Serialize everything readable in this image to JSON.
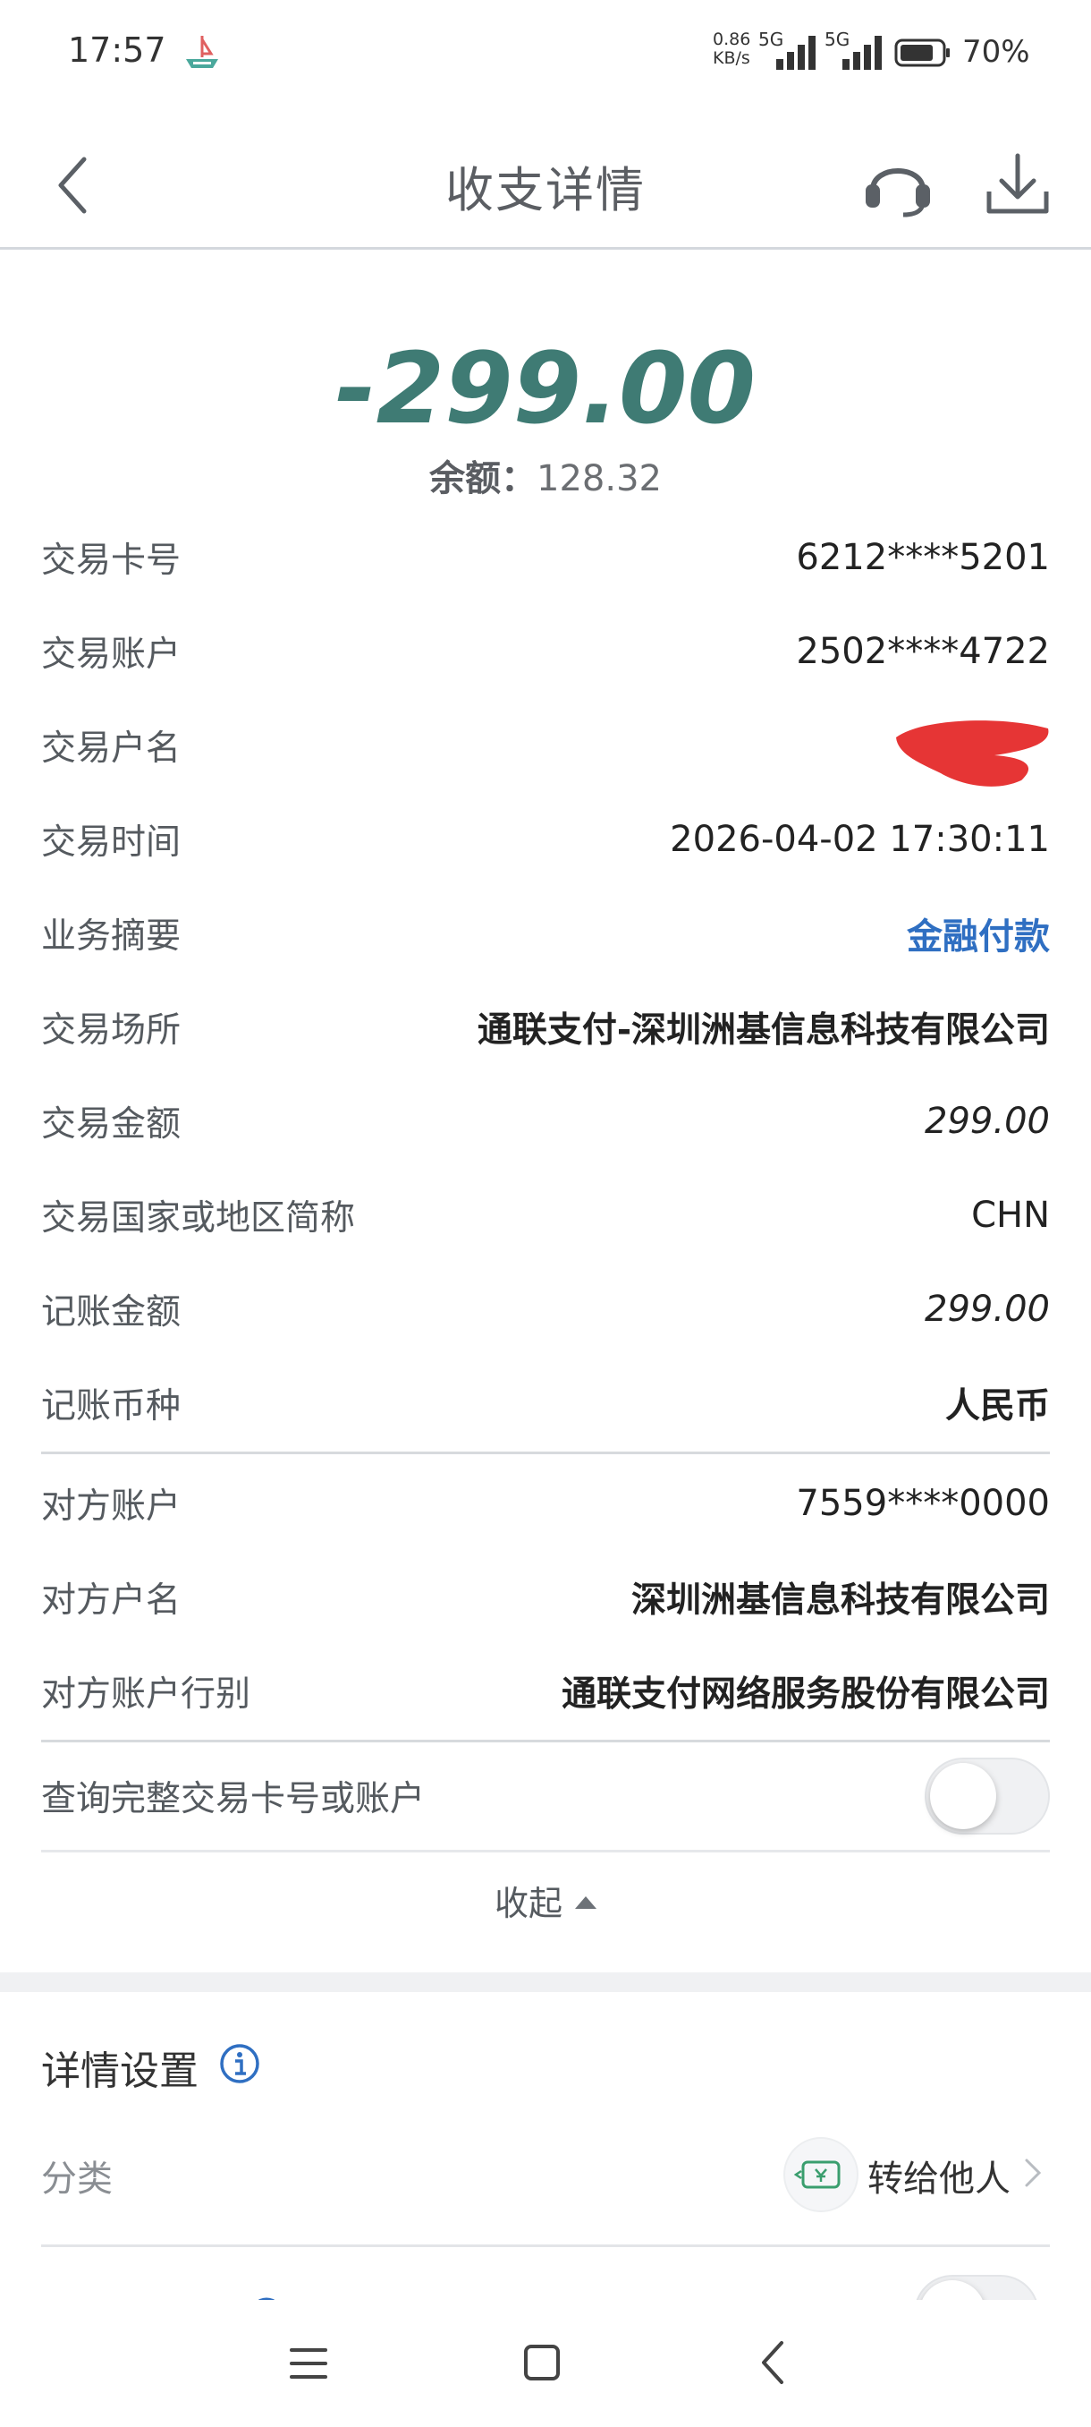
{
  "status_bar": {
    "time": "17:57",
    "net_speed_value": "0.86",
    "net_speed_unit": "KB/s",
    "network_1": "5G",
    "network_2": "5G",
    "battery_pct": "70%"
  },
  "nav": {
    "title": "收支详情",
    "icons": [
      "back-icon",
      "headset-icon",
      "download-icon"
    ]
  },
  "summary": {
    "amount": "-299.00",
    "balance_label": "余额：",
    "balance_value": "128.32"
  },
  "details": [
    {
      "label": "交易卡号",
      "value": "6212****5201"
    },
    {
      "label": "交易账户",
      "value": "2502****4722"
    },
    {
      "label": "交易户名",
      "value": ""
    },
    {
      "label": "交易时间",
      "value": "2026-04-02 17:30:11"
    },
    {
      "label": "业务摘要",
      "value": "金融付款"
    },
    {
      "label": "交易场所",
      "value": "通联支付-深圳洲基信息科技有限公司"
    },
    {
      "label": "交易金额",
      "value": "299.00"
    },
    {
      "label": "交易国家或地区简称",
      "value": "CHN"
    },
    {
      "label": "记账金额",
      "value": "299.00"
    },
    {
      "label": "记账币种",
      "value": "人民币"
    },
    {
      "label": "对方账户",
      "value": "7559****0000"
    },
    {
      "label": "对方户名",
      "value": "深圳洲基信息科技有限公司"
    },
    {
      "label": "对方账户行别",
      "value": "通联支付网络服务股份有限公司"
    }
  ],
  "query_full": {
    "label": "查询完整交易卡号或账户",
    "enabled": false
  },
  "collapse_label": "收起",
  "settings": {
    "title": "详情设置",
    "category_label": "分类",
    "category_value": "转给他人"
  },
  "colors": {
    "amount": "#3f7b74",
    "link": "#2f6fc2",
    "info_icon": "#2f6fc2",
    "category_badge_icon": "#3a9e6e"
  }
}
